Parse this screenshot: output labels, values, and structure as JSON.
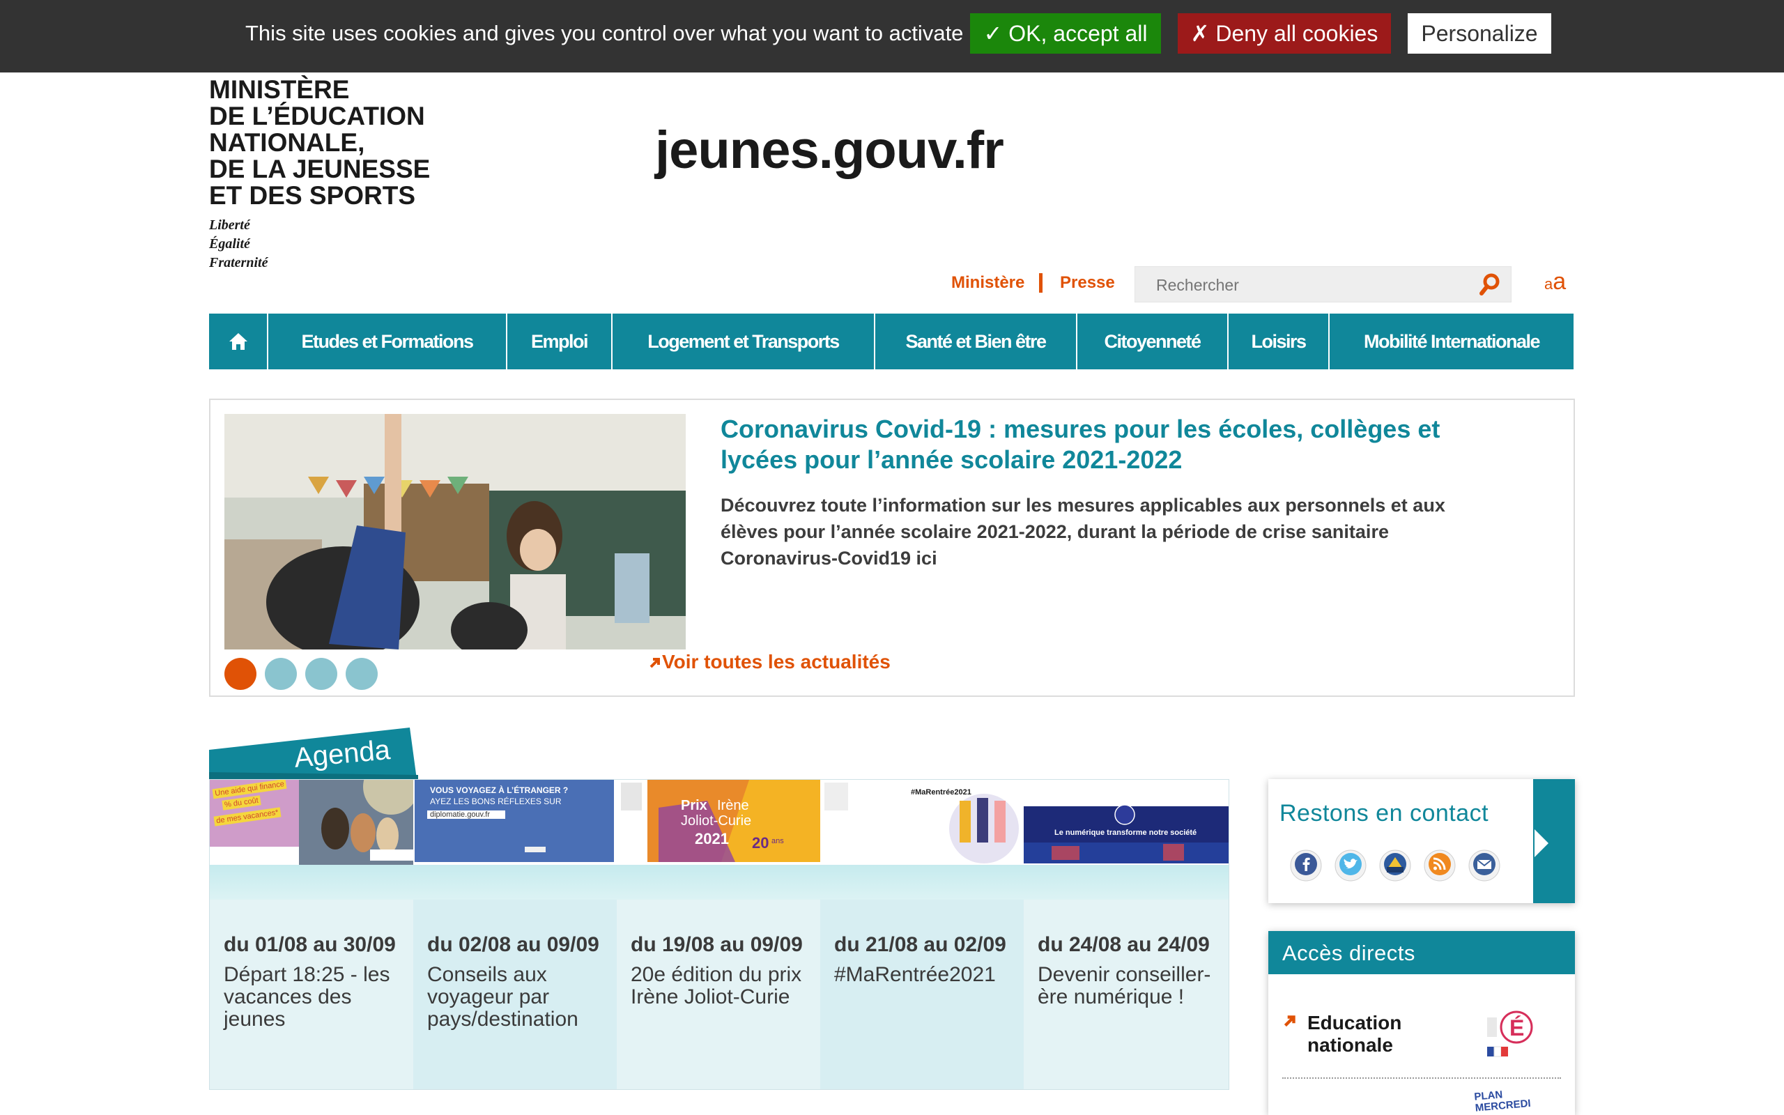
{
  "cookie_bar": {
    "message": "This site uses cookies and gives you control over what you want to activate",
    "accept_label": "✓ OK, accept all",
    "deny_label": "✗ Deny all cookies",
    "personalize_label": "Personalize"
  },
  "header": {
    "ministry_lines": [
      "MINISTÈRE",
      "DE L’ÉDUCATION",
      "NATIONALE,",
      "DE LA JEUNESSE",
      "ET DES SPORTS"
    ],
    "motto": [
      "Liberté",
      "Égalité",
      "Fraternité"
    ],
    "site_name": "jeunes.gouv.fr",
    "link_ministere": "Ministère",
    "link_presse": "Presse",
    "search_placeholder": "Rechercher",
    "font_small": "a",
    "font_big": "a"
  },
  "nav": {
    "items": [
      "Etudes et Formations",
      "Emploi",
      "Logement et Transports",
      "Santé et Bien être",
      "Citoyenneté",
      "Loisirs",
      "Mobilité Internationale"
    ]
  },
  "news": {
    "title": "Coronavirus Covid-19 : mesures pour les écoles, collèges et lycées pour l’année scolaire 2021-2022",
    "description": "Découvrez toute l’information sur les mesures applicables aux personnels et aux élèves pour l’année scolaire 2021-2022, durant la période de crise sanitaire Coronavirus-Covid19 ici",
    "see_all": "Voir toutes les actualités",
    "slide_count": 4,
    "active_slide": 1
  },
  "agenda": {
    "title": "Agenda",
    "items": [
      {
        "date": "du 01/08 au 30/09",
        "title": "Départ 18:25 - les vacances des jeunes"
      },
      {
        "date": "du 02/08 au 09/09",
        "title": "Conseils aux voyageur par pays/destination"
      },
      {
        "date": "du 19/08 au 09/09",
        "title": "20e édition du prix Irène Joliot-Curie"
      },
      {
        "date": "du 21/08 au 02/09",
        "title": "#MaRentrée2021"
      },
      {
        "date": "du 24/08 au 24/09",
        "title": "Devenir conseiller-ère numérique !"
      }
    ],
    "thumb_texts": {
      "t1": [
        "Une aide qui finance",
        "% du coût",
        "de mes vacances*"
      ],
      "t2": [
        "VOUS VOYAGEZ À L’ÉTRANGER ?",
        "AYEZ LES BONS RÉFLEXES SUR",
        "diplomatie.gouv.fr"
      ],
      "t3": [
        "Prix",
        "Irène",
        "Joliot-Curie",
        "2021",
        "20",
        "ans"
      ],
      "t4": [
        "#MaRentrée2021"
      ],
      "t5": [
        "Le numérique transforme notre société"
      ]
    }
  },
  "contact": {
    "title": "Restons en contact",
    "icons": [
      "facebook-icon",
      "twitter-icon",
      "dailymotion-icon",
      "rss-icon",
      "newsletter-icon"
    ]
  },
  "acces": {
    "title": "Accès directs",
    "items": [
      "Education nationale"
    ],
    "logo_text": "PLAN MERCREDI"
  },
  "colors": {
    "teal": "#10879a",
    "orange": "#e05206",
    "cookie_bg": "#333333",
    "accept_green": "#1b870b",
    "deny_red": "#9c1a1a"
  }
}
